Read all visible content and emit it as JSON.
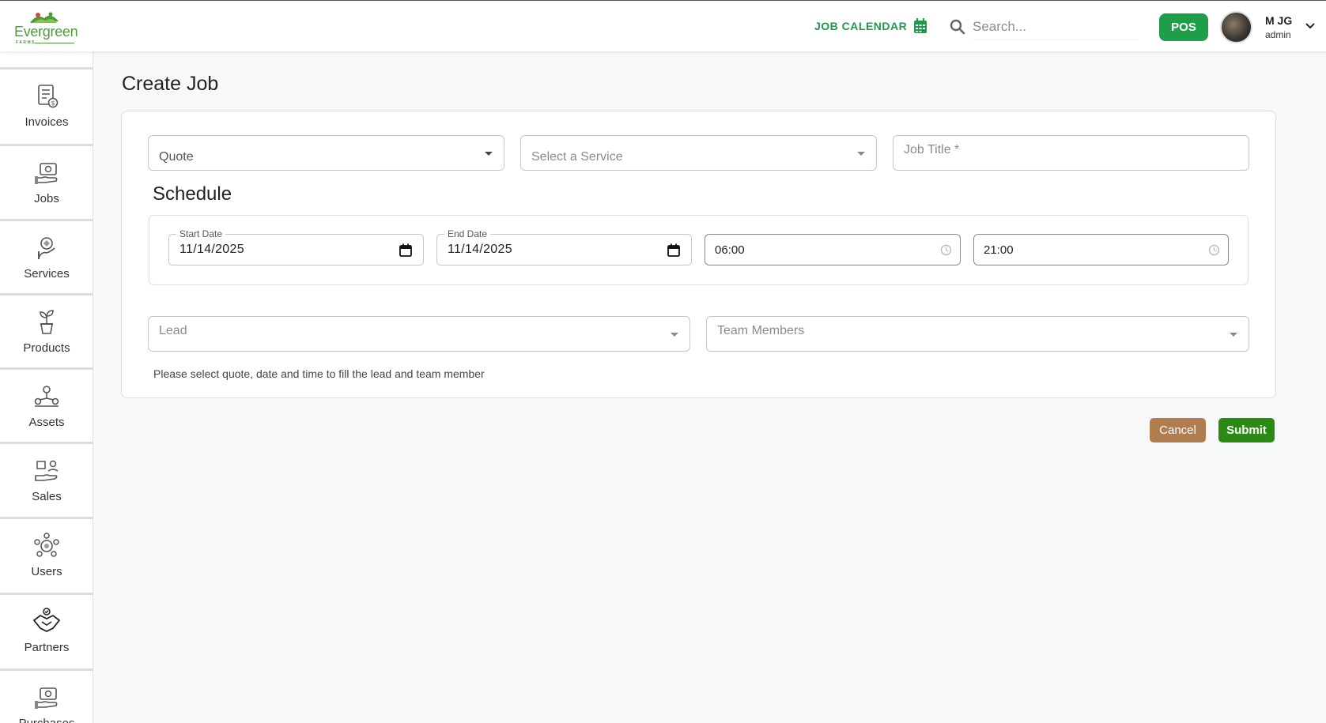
{
  "brand": {
    "name": "Evergreen",
    "sub": "FARMS"
  },
  "header": {
    "job_calendar": "JOB CALENDAR",
    "search_placeholder": "Search...",
    "pos_label": "POS",
    "user_name": "M JG",
    "user_role": "admin"
  },
  "sidebar": {
    "items": [
      {
        "label": "Invoices",
        "icon": "invoice-icon"
      },
      {
        "label": "Jobs",
        "icon": "jobs-icon"
      },
      {
        "label": "Services",
        "icon": "services-icon"
      },
      {
        "label": "Products",
        "icon": "plant-pot-icon"
      },
      {
        "label": "Assets",
        "icon": "assets-icon"
      },
      {
        "label": "Sales",
        "icon": "sales-icon"
      },
      {
        "label": "Users",
        "icon": "users-icon"
      },
      {
        "label": "Partners",
        "icon": "handshake-icon"
      },
      {
        "label": "Purchases",
        "icon": "purchases-icon"
      }
    ]
  },
  "page": {
    "title": "Create Job",
    "quote_value": "Quote",
    "service_placeholder": "Select a Service",
    "job_title_placeholder": "Job Title *",
    "schedule_title": "Schedule",
    "start_date_label": "Start Date",
    "start_date_value": "11/14/2025",
    "end_date_label": "End Date",
    "end_date_value": "11/14/2025",
    "start_time": "06:00",
    "end_time": "21:00",
    "lead_placeholder": "Lead",
    "team_placeholder": "Team Members",
    "helper_text": "Please select quote, date and time to fill the lead and team member",
    "cancel_label": "Cancel",
    "submit_label": "Submit"
  },
  "colors": {
    "brand_green": "#1e9e48",
    "submit_green": "#2a8a14",
    "cancel_brown": "#b07d4e"
  }
}
